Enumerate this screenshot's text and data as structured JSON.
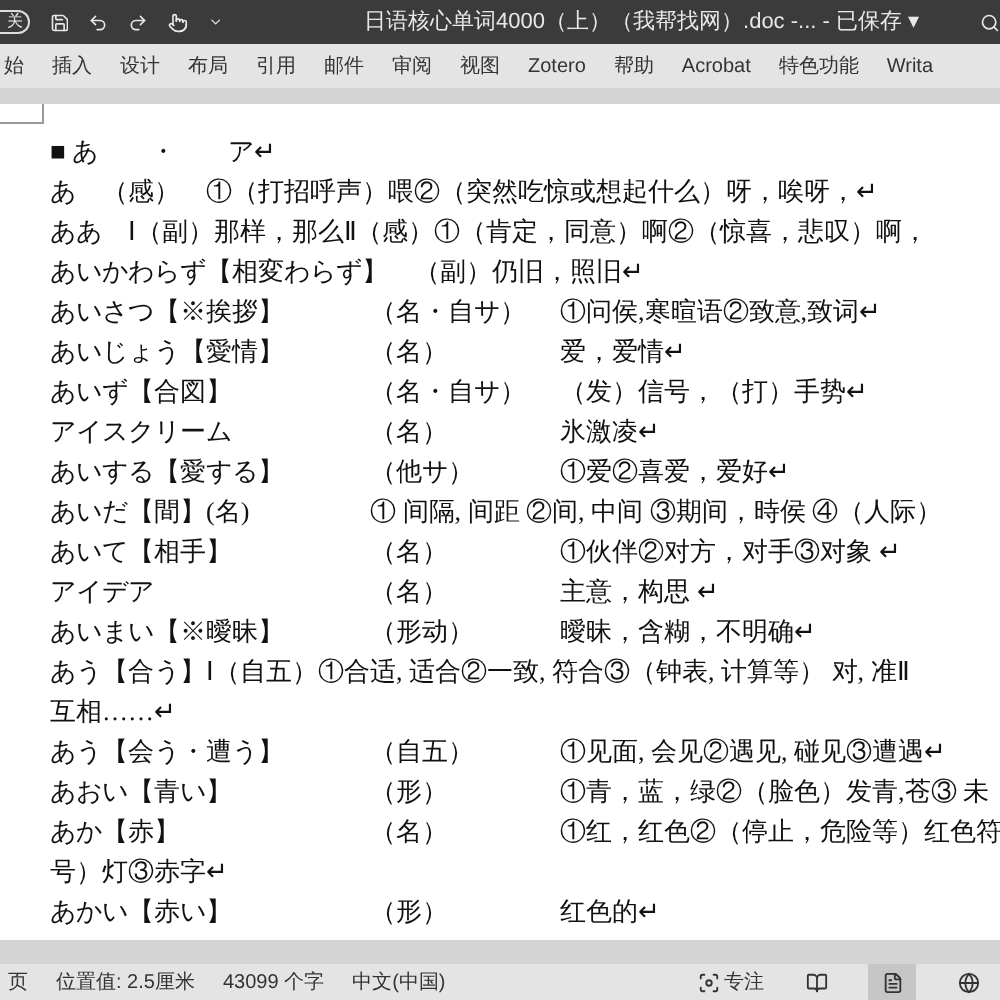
{
  "title_bar": {
    "autosave": "关",
    "title": "日语核心单词4000（上）（我帮找网）.doc -...  - 已保存 ▾"
  },
  "ribbon_tabs": [
    {
      "label": "始",
      "selected": false
    },
    {
      "label": "插入",
      "selected": false
    },
    {
      "label": "设计",
      "selected": false
    },
    {
      "label": "布局",
      "selected": false
    },
    {
      "label": "引用",
      "selected": false
    },
    {
      "label": "邮件",
      "selected": false
    },
    {
      "label": "审阅",
      "selected": false
    },
    {
      "label": "视图",
      "selected": false
    },
    {
      "label": "Zotero",
      "selected": false
    },
    {
      "label": "帮助",
      "selected": false
    },
    {
      "label": "Acrobat",
      "selected": false
    },
    {
      "label": "特色功能",
      "selected": false
    },
    {
      "label": "Writa",
      "selected": false
    }
  ],
  "document_lines": [
    {
      "kind": "text",
      "text": "■ あ　　・　　ア↵"
    },
    {
      "kind": "text",
      "text": "あ　（感）　①（打招呼声）喂②（突然吃惊或想起什么）呀，唉呀，↵"
    },
    {
      "kind": "text",
      "text": "ああ　Ⅰ（副）那样，那么Ⅱ（感）①（肯定，同意）啊②（惊喜，悲叹）啊，"
    },
    {
      "kind": "text",
      "text": "あいかわらず【相変わらず】　（副）仍旧，照旧↵"
    },
    {
      "kind": "entry",
      "word": "あいさつ【※挨拶】",
      "pos": "（名・自サ）",
      "meaning": "①问侯,寒暄语②致意,致词↵"
    },
    {
      "kind": "entry",
      "word": "あいじょう【愛情】",
      "pos": "（名）",
      "meaning": "爱，爱情↵"
    },
    {
      "kind": "entry",
      "word": "あいず【合図】",
      "pos": "（名・自サ）",
      "meaning": "（发）信号，（打）手势↵"
    },
    {
      "kind": "entry",
      "word": "アイスクリーム",
      "pos": "（名）",
      "meaning": "氷激凌↵"
    },
    {
      "kind": "entry",
      "word": "あいする【愛する】",
      "pos": "（他サ）",
      "meaning": "①爱②喜爱，爱好↵"
    },
    {
      "kind": "entry",
      "word": "あいだ【間】(名)",
      "pos": "① 间隔, 间距 ②间, 中间 ③期间，時侯 ④（人际）"
    },
    {
      "kind": "entry",
      "word": "あいて【相手】",
      "pos": "（名）",
      "meaning": "①伙伴②对方，对手③对象 ↵"
    },
    {
      "kind": "entry",
      "word": "アイデア",
      "pos": "（名）",
      "meaning": "主意，构思 ↵"
    },
    {
      "kind": "entry",
      "word": "あいまい【※曖昧】",
      "pos": "（形动）",
      "meaning": "曖昧，含糊，不明确↵"
    },
    {
      "kind": "text",
      "text": "あう【合う】Ⅰ（自五）①合适, 适合②一致, 符合③（钟表, 计算等） 对, 准Ⅱ"
    },
    {
      "kind": "text",
      "text": "互相……↵"
    },
    {
      "kind": "entry",
      "word": "あう【会う・遭う】",
      "pos": "（自五）",
      "meaning": "①见面, 会见②遇见, 碰见③遭遇↵"
    },
    {
      "kind": "entry",
      "word": "あおい【青い】",
      "pos": "（形）",
      "meaning": "①青，蓝，绿②（脸色）发青,苍③ 未"
    },
    {
      "kind": "entry",
      "word": "あか【赤】",
      "pos": "（名）",
      "meaning": "①红，红色②（停止，危险等）红色符"
    },
    {
      "kind": "text",
      "text": "号）灯③赤字↵"
    },
    {
      "kind": "entry",
      "word": "あかい【赤い】",
      "pos": "（形）",
      "meaning": "红色的↵"
    }
  ],
  "status_bar": {
    "page": "页",
    "position": "位置值: 2.5厘米",
    "word_count": "43099 个字",
    "language": "中文(中国)",
    "focus": "专注",
    "views": [
      {
        "selected": false
      },
      {
        "selected": true
      },
      {
        "selected": false
      }
    ]
  }
}
